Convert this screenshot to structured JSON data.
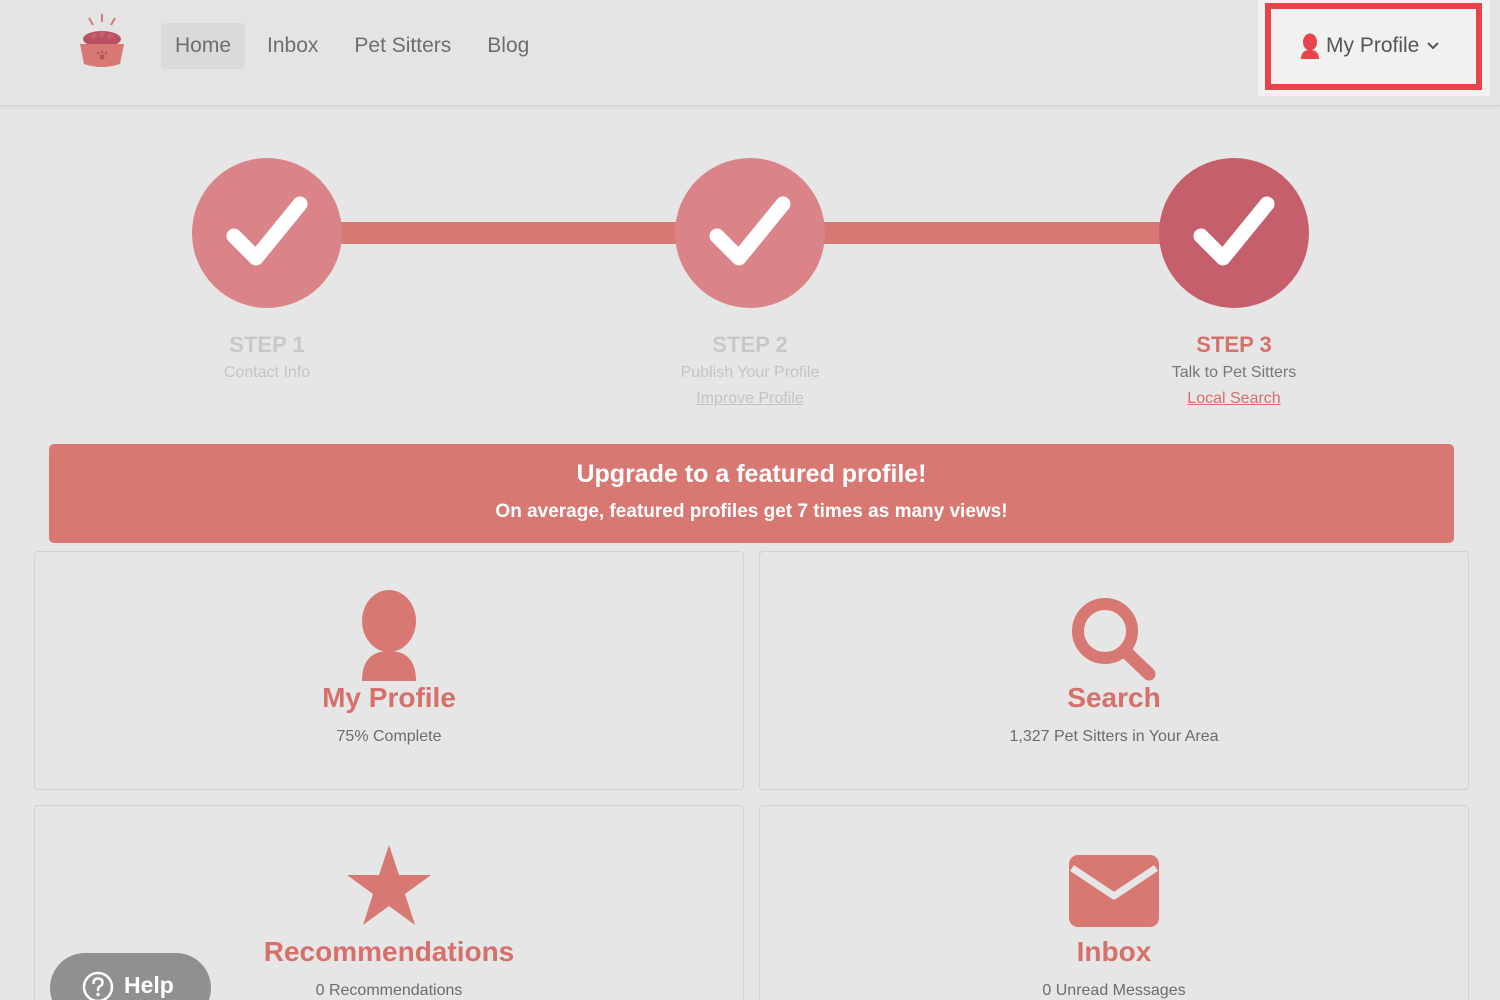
{
  "nav": {
    "items": [
      {
        "label": "Home",
        "active": true
      },
      {
        "label": "Inbox",
        "active": false
      },
      {
        "label": "Pet Sitters",
        "active": false
      },
      {
        "label": "Blog",
        "active": false
      }
    ],
    "profile_label": "My Profile"
  },
  "steps": [
    {
      "label": "STEP 1",
      "sub": "Contact Info",
      "link": "",
      "state": "done"
    },
    {
      "label": "STEP 2",
      "sub": "Publish Your Profile",
      "link": "Improve Profile",
      "state": "done"
    },
    {
      "label": "STEP 3",
      "sub": "Talk to Pet Sitters",
      "link": "Local Search",
      "state": "current"
    }
  ],
  "banner": {
    "title": "Upgrade to a featured profile!",
    "subtitle": "On average, featured profiles get 7 times as many views!"
  },
  "cards": {
    "profile": {
      "title": "My Profile",
      "subtitle": "75% Complete",
      "icon": "person-icon"
    },
    "search": {
      "title": "Search",
      "subtitle": "1,327 Pet Sitters in Your Area",
      "icon": "magnifier-icon"
    },
    "recommendations": {
      "title": "Recommendations",
      "subtitle": "0 Recommendations",
      "icon": "star-icon"
    },
    "inbox": {
      "title": "Inbox",
      "subtitle": "0 Unread Messages",
      "icon": "envelope-icon"
    }
  },
  "help": {
    "label": "Help"
  },
  "colors": {
    "accent": "#d77873",
    "step_done": "#da848a",
    "step_current": "#c55f6c",
    "highlight": "#e8424a",
    "background": "#e6e6e6"
  }
}
